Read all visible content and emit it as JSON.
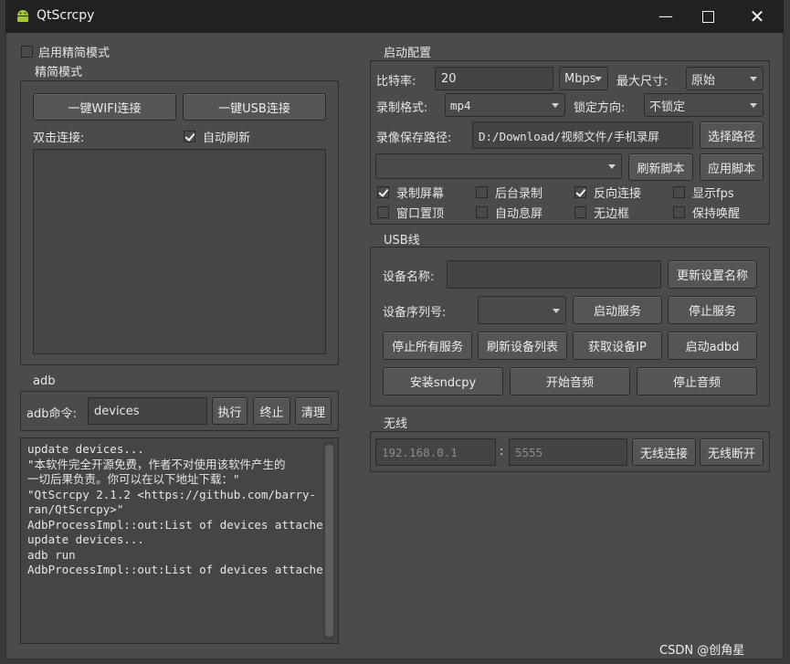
{
  "window": {
    "title": "QtScrcpy"
  },
  "simple_mode": {
    "enable_label": "启用精简模式",
    "group_title": "精简模式",
    "wifi_button": "一键WIFI连接",
    "usb_button": "一键USB连接",
    "double_click_label": "双击连接:",
    "auto_refresh_label": "自动刷新",
    "auto_refresh_checked": true
  },
  "adb": {
    "group_title": "adb",
    "command_label": "adb命令:",
    "command_value": "devices",
    "execute": "执行",
    "stop": "终止",
    "clear": "清理"
  },
  "log_lines": [
    "update devices...",
    "\"本软件完全开源免费，作者不对使用该软件产生的",
    "一切后果负责。你可以在以下地址下载：\"",
    "",
    "\"QtScrcpy 2.1.2 <https://github.com/barry-",
    "ran/QtScrcpy>\"",
    "",
    "AdbProcessImpl::out:List of devices attached",
    "",
    "update devices...",
    "adb run",
    "AdbProcessImpl::out:List of devices attached"
  ],
  "startup": {
    "group_title": "启动配置",
    "bitrate_label": "比特率:",
    "bitrate_value": "20",
    "bitrate_unit": "Mbps",
    "max_size_label": "最大尺寸:",
    "max_size_value": "原始",
    "record_format_label": "录制格式:",
    "record_format_value": "mp4",
    "lock_orientation_label": "锁定方向:",
    "lock_orientation_value": "不锁定",
    "record_path_label": "录像保存路径:",
    "record_path_value": "D:/Download/视频文件/手机录屏",
    "select_path_button": "选择路径",
    "script_value": "",
    "refresh_script_button": "刷新脚本",
    "apply_script_button": "应用脚本",
    "checkboxes": [
      {
        "label": "录制屏幕",
        "checked": true
      },
      {
        "label": "后台录制",
        "checked": false
      },
      {
        "label": "反向连接",
        "checked": true
      },
      {
        "label": "显示fps",
        "checked": false
      },
      {
        "label": "窗口置顶",
        "checked": false
      },
      {
        "label": "自动息屏",
        "checked": false
      },
      {
        "label": "无边框",
        "checked": false
      },
      {
        "label": "保持唤醒",
        "checked": false
      }
    ]
  },
  "usb": {
    "group_title": "USB线",
    "device_name_label": "设备名称:",
    "device_name_value": "",
    "update_name_button": "更新设置名称",
    "serial_label": "设备序列号:",
    "serial_value": "",
    "start_service": "启动服务",
    "stop_service": "停止服务",
    "stop_all": "停止所有服务",
    "refresh_devices": "刷新设备列表",
    "get_ip": "获取设备IP",
    "start_adbd": "启动adbd",
    "install_sndcpy": "安装sndcpy",
    "start_audio": "开始音频",
    "stop_audio": "停止音频"
  },
  "wireless": {
    "group_title": "无线",
    "ip_placeholder": "192.168.0.1",
    "separator": ":",
    "port_placeholder": "5555",
    "connect": "无线连接",
    "disconnect": "无线断开"
  },
  "watermark": "CSDN @创角星"
}
